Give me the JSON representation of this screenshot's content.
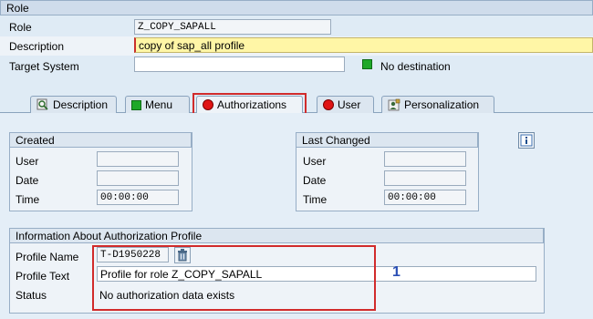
{
  "header": {
    "section_title": "Role",
    "role_label": "Role",
    "role_value": "Z_COPY_SAPALL",
    "description_label": "Description",
    "description_value": "copy of sap_all profile",
    "target_system_label": "Target System",
    "target_system_value": "",
    "destination_status": "No destination"
  },
  "tabs": [
    {
      "label": "Description",
      "icon": "magnifier-icon",
      "active": false
    },
    {
      "label": "Menu",
      "icon": "green-square-icon",
      "active": false
    },
    {
      "label": "Authorizations",
      "icon": "red-circle-icon",
      "active": true
    },
    {
      "label": "User",
      "icon": "red-circle-icon",
      "active": false
    },
    {
      "label": "Personalization",
      "icon": "person-settings-icon",
      "active": false
    }
  ],
  "created": {
    "title": "Created",
    "user_label": "User",
    "user_value": "",
    "date_label": "Date",
    "date_value": "",
    "time_label": "Time",
    "time_value": "00:00:00"
  },
  "last_changed": {
    "title": "Last Changed",
    "user_label": "User",
    "user_value": "",
    "date_label": "Date",
    "date_value": "",
    "time_label": "Time",
    "time_value": "00:00:00"
  },
  "auth_profile": {
    "title": "Information About Authorization Profile",
    "profile_name_label": "Profile Name",
    "profile_name_value": "T-D1950228",
    "profile_text_label": "Profile Text",
    "profile_text_value": "Profile for role Z_COPY_SAPALL",
    "status_label": "Status",
    "status_value": "No authorization data exists"
  },
  "annotation": "1",
  "colors": {
    "background": "#dfebf5",
    "highlight_red": "#d12b2b",
    "annotation_blue": "#2a4fb5",
    "status_green": "#1ea829",
    "status_red": "#e01414"
  }
}
